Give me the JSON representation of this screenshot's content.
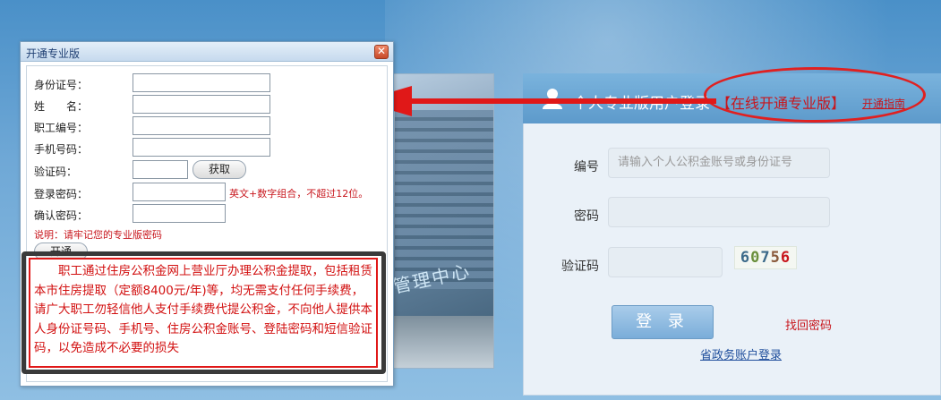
{
  "login": {
    "header_title": "个人专业版用户登录",
    "header_bracket": "【在线开通专业版】",
    "guide_link": "开通指南",
    "fields": {
      "id_label": "编号",
      "id_placeholder": "请输入个人公积金账号或身份证号",
      "password_label": "密码",
      "captcha_label": "验证码"
    },
    "captcha_digits": [
      "6",
      "0",
      "7",
      "5",
      "6"
    ],
    "login_button": "登 录",
    "forgot_link": "找回密码",
    "gov_link": "省政务账户登录"
  },
  "photo": {
    "sign_text": "管理中心"
  },
  "dialog": {
    "title": "开通专业版",
    "close_glyph": "✕",
    "fields": {
      "id_card": "身份证号：",
      "name": "姓　　名：",
      "employee_no": "职工编号：",
      "phone": "手机号码：",
      "captcha": "验证码：",
      "login_password": "登录密码：",
      "confirm_password": "确认密码："
    },
    "get_button": "获取",
    "password_hint": "英文+数字组合，不超过12位。",
    "note": "说明：请牢记您的专业版密码",
    "open_button": "开通",
    "warning": "职工通过住房公积金网上营业厅办理公积金提取，包括租赁本市住房提取（定额8400元/年)等，均无需支付任何手续费，请广大职工勿轻信他人支付手续费代提公积金，不向他人提供本人身份证号码、手机号、住房公积金账号、登陆密码和短信验证码，以免造成不必要的损失"
  },
  "colors": {
    "accent_red": "#c8161d",
    "link_blue": "#1f4e9c",
    "header_blue": "#5d9acb"
  }
}
